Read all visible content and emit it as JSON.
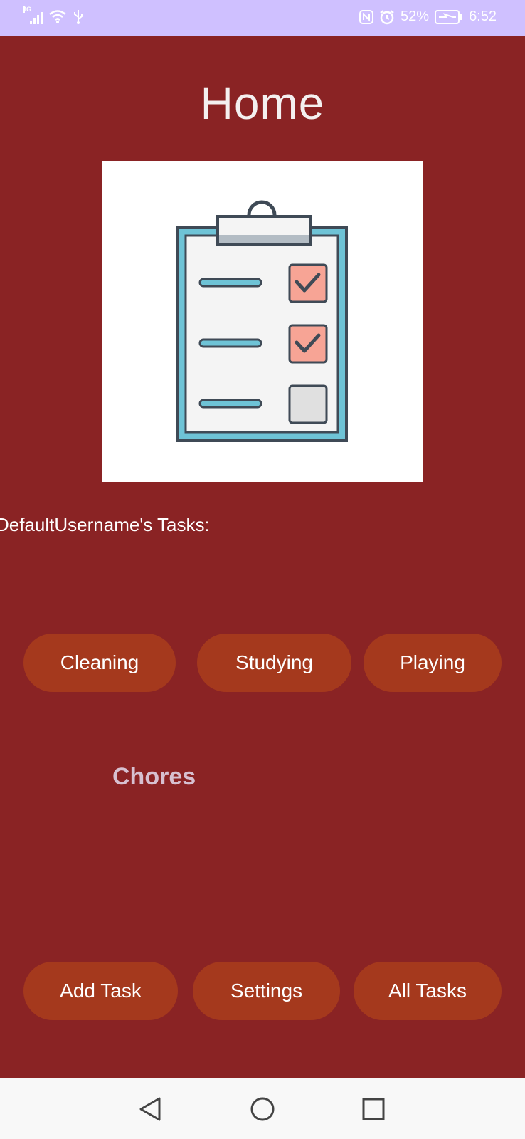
{
  "status_bar": {
    "network_tag": "3G",
    "battery_percent": "52%",
    "time": "6:52",
    "icons": [
      "signal-icon",
      "wifi-icon",
      "usb-icon",
      "nfc-icon",
      "alarm-icon",
      "battery-charging-icon"
    ]
  },
  "page": {
    "title": "Home",
    "tasks_heading": "DefaultUsername's Tasks:"
  },
  "categories": [
    {
      "label": "Cleaning"
    },
    {
      "label": "Studying"
    },
    {
      "label": "Playing"
    }
  ],
  "section": {
    "label": "Chores"
  },
  "bottom_actions": {
    "add_task": "Add Task",
    "settings": "Settings",
    "all_tasks": "All Tasks"
  },
  "nav_bar": {
    "icons": [
      "back-icon",
      "home-icon",
      "recents-icon"
    ]
  },
  "colors": {
    "background": "#8a2324",
    "button": "#a5391d",
    "status_bar": "#cfc0ff",
    "nav_bar": "#f8f8f8",
    "section_label": "#d7c0d0"
  }
}
